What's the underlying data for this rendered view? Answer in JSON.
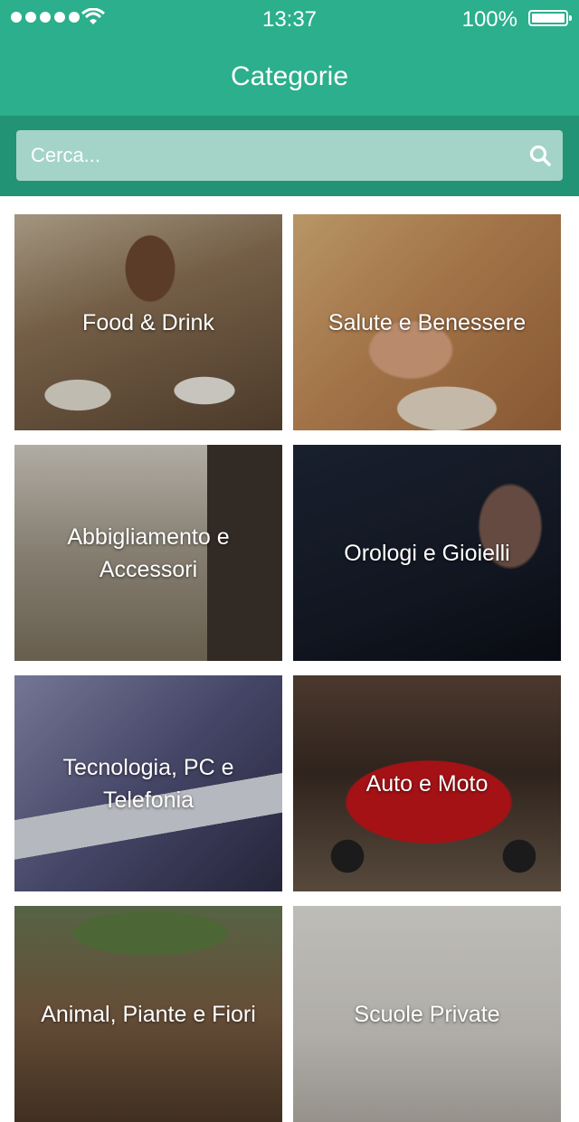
{
  "status_bar": {
    "time": "13:37",
    "battery": "100%"
  },
  "header": {
    "title": "Categorie"
  },
  "search": {
    "placeholder": "Cerca..."
  },
  "categories": [
    {
      "label": "Food & Drink"
    },
    {
      "label": "Salute e Benessere"
    },
    {
      "label": "Abbigliamento e Accessori"
    },
    {
      "label": "Orologi e Gioielli"
    },
    {
      "label": "Tecnologia, PC e Telefonia"
    },
    {
      "label": "Auto e Moto"
    },
    {
      "label": "Animal, Piante e Fiori"
    },
    {
      "label": "Scuole Private"
    }
  ],
  "colors": {
    "primary": "#2baf8d",
    "primary_dark": "#229375",
    "search_field": "#a4d4c7"
  },
  "icons": {
    "signal": "signal-dots-icon",
    "wifi": "wifi-icon",
    "battery": "battery-icon",
    "search": "search-icon"
  }
}
